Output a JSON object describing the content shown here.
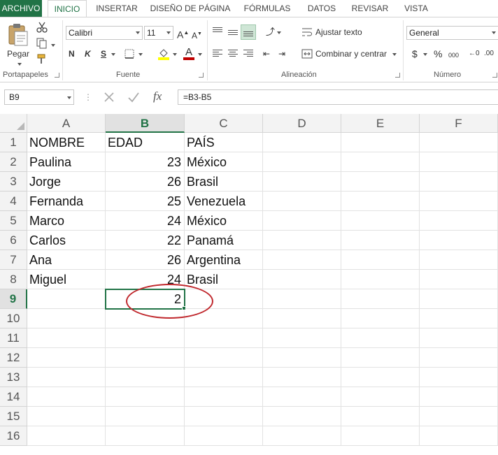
{
  "tabs": [
    "ARCHIVO",
    "INICIO",
    "INSERTAR",
    "DISEÑO DE PÁGINA",
    "FÓRMULAS",
    "DATOS",
    "REVISAR",
    "VISTA"
  ],
  "ribbon": {
    "clipboard": {
      "paste_label": "Pegar",
      "group_label": "Portapapeles"
    },
    "font": {
      "name": "Calibri",
      "size": "11",
      "grow_icon": "A",
      "shrink_icon": "A",
      "bold": "N",
      "italic": "K",
      "underline": "S",
      "font_color_icon": "A",
      "group_label": "Fuente"
    },
    "alignment": {
      "wrap_text": "Ajustar texto",
      "merge_center": "Combinar y centrar",
      "group_label": "Alineación"
    },
    "number": {
      "format": "General",
      "currency": "$",
      "percent": "%",
      "thousands": "000",
      "group_label": "Número"
    }
  },
  "formula_bar": {
    "name_box": "B9",
    "fx": "fx",
    "formula": "=B3-B5"
  },
  "grid": {
    "columns": [
      "A",
      "B",
      "C",
      "D",
      "E",
      "F"
    ],
    "selected_column": "B",
    "rows": [
      "1",
      "2",
      "3",
      "4",
      "5",
      "6",
      "7",
      "8",
      "9",
      "10",
      "11",
      "12",
      "13",
      "14",
      "15",
      "16"
    ],
    "selected_row": "9",
    "cells": [
      [
        "NOMBRE",
        "EDAD",
        "PAÍS"
      ],
      [
        "Paulina",
        "23",
        "México"
      ],
      [
        "Jorge",
        "26",
        "Brasil"
      ],
      [
        "Fernanda",
        "25",
        "Venezuela"
      ],
      [
        "Marco",
        "24",
        "México"
      ],
      [
        "Carlos",
        "22",
        "Panamá"
      ],
      [
        "Ana",
        "26",
        "Argentina"
      ],
      [
        "Miguel",
        "24",
        "Brasil"
      ],
      [
        "",
        "2",
        ""
      ]
    ]
  },
  "colors": {
    "excel_green": "#217346",
    "annotation_red": "#c0282d"
  }
}
